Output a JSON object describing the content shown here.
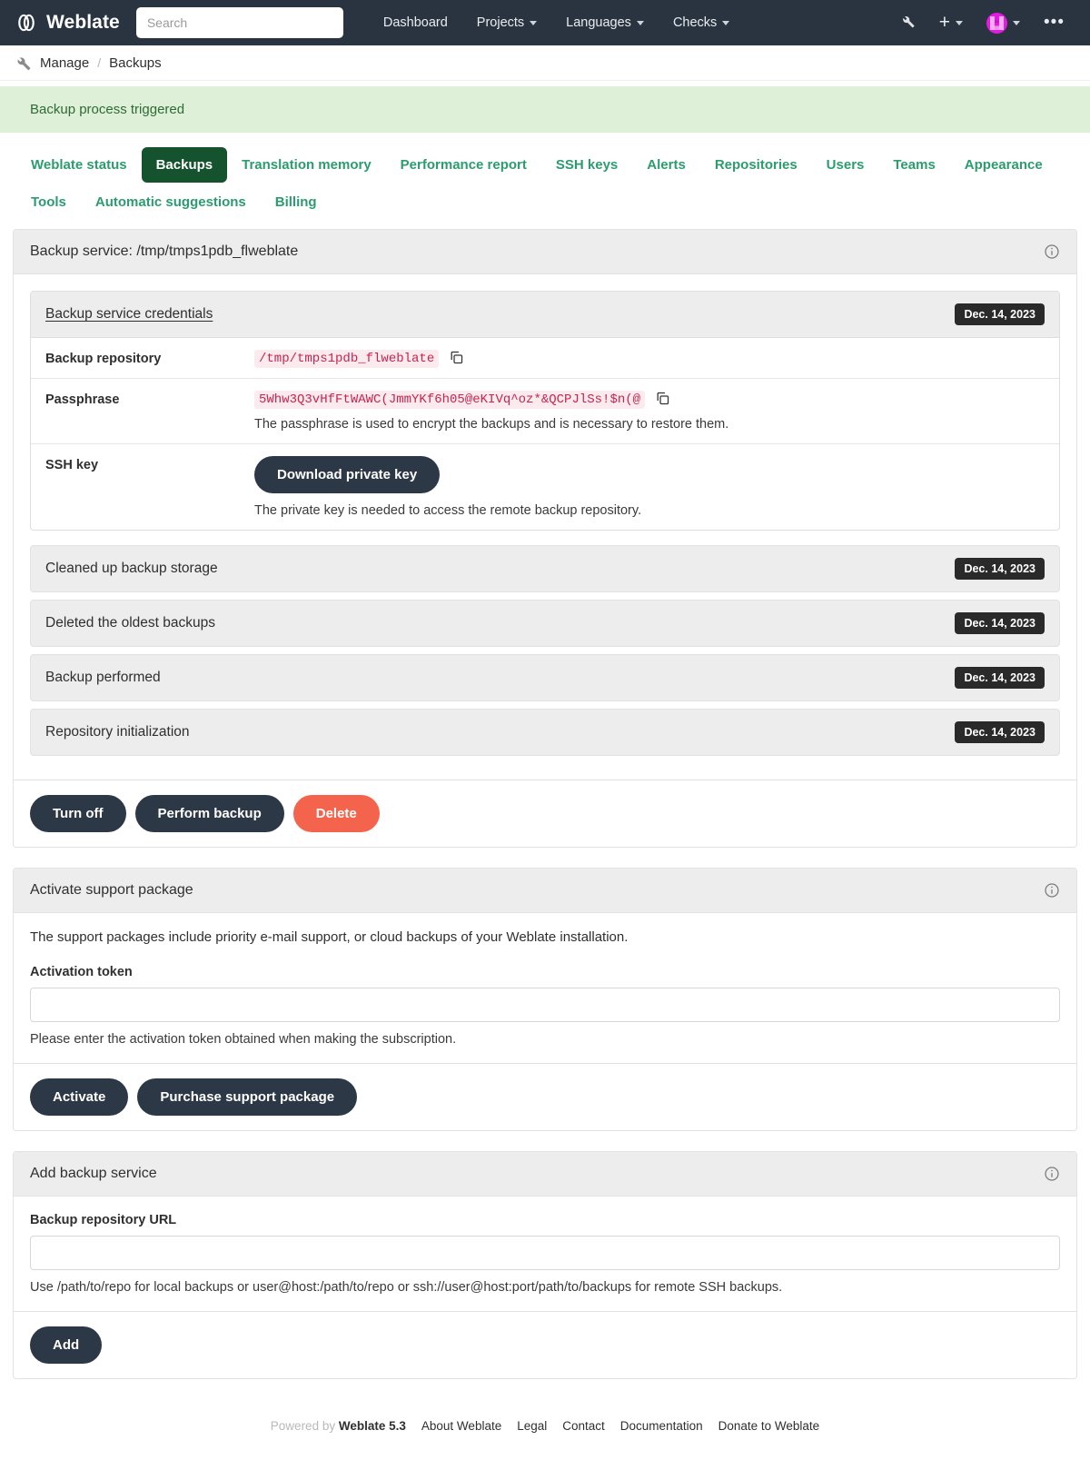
{
  "navbar": {
    "brand": "Weblate",
    "brand_logo_icon": "weblate-logo-icon",
    "search_placeholder": "Search",
    "search_value": "",
    "links": [
      {
        "label": "Dashboard",
        "has_caret": false
      },
      {
        "label": "Projects",
        "has_caret": true
      },
      {
        "label": "Languages",
        "has_caret": true
      },
      {
        "label": "Checks",
        "has_caret": true
      }
    ],
    "right": {
      "wrench_icon": "wrench-icon",
      "plus_glyph": "+",
      "avatar_icon": "user-avatar-icon",
      "more_glyph": "•••"
    }
  },
  "breadcrumb": {
    "icon": "wrench-icon",
    "items": [
      "Manage",
      "Backups"
    ],
    "separator": "/"
  },
  "alert": {
    "message": "Backup process triggered",
    "bg_color": "#dff0d8",
    "text_color": "#2e6b35"
  },
  "tabs": {
    "active": "Backups",
    "items": [
      "Weblate status",
      "Backups",
      "Translation memory",
      "Performance report",
      "SSH keys",
      "Alerts",
      "Repositories",
      "Users",
      "Teams",
      "Appearance",
      "Tools",
      "Automatic suggestions",
      "Billing"
    ],
    "active_bg": "#14532d",
    "link_color": "#2c9c6f"
  },
  "backup_service": {
    "title": "Backup service: /tmp/tmps1pdb_flweblate",
    "info_icon": "info-icon",
    "credentials": {
      "title": "Backup service credentials",
      "date": "Dec. 14, 2023",
      "rows": [
        {
          "label": "Backup repository",
          "value": "/tmp/tmps1pdb_flweblate",
          "copy_icon": "copy-icon",
          "help": ""
        },
        {
          "label": "Passphrase",
          "value": "5Whw3Q3vHfFtWAWC(JmmYKf6h05@eKIVq^oz*&QCPJlSs!$n(@",
          "copy_icon": "copy-icon",
          "help": "The passphrase is used to encrypt the backups and is necessary to restore them."
        }
      ],
      "ssh_key": {
        "label": "SSH key",
        "button_label": "Download private key",
        "help": "The private key is needed to access the remote backup repository."
      }
    },
    "log_entries": [
      {
        "label": "Cleaned up backup storage",
        "date": "Dec. 14, 2023"
      },
      {
        "label": "Deleted the oldest backups",
        "date": "Dec. 14, 2023"
      },
      {
        "label": "Backup performed",
        "date": "Dec. 14, 2023"
      },
      {
        "label": "Repository initialization",
        "date": "Dec. 14, 2023"
      }
    ],
    "actions": {
      "turn_off": "Turn off",
      "perform_backup": "Perform backup",
      "delete": "Delete",
      "delete_color": "#f4644c"
    }
  },
  "support_package": {
    "title": "Activate support package",
    "info_icon": "info-icon",
    "description": "The support packages include priority e-mail support, or cloud backups of your Weblate installation.",
    "token_label": "Activation token",
    "token_value": "",
    "token_placeholder": "",
    "token_help": "Please enter the activation token obtained when making the subscription.",
    "activate_label": "Activate",
    "purchase_label": "Purchase support package"
  },
  "add_backup_service": {
    "title": "Add backup service",
    "info_icon": "info-icon",
    "url_label": "Backup repository URL",
    "url_value": "",
    "url_placeholder": "",
    "url_help": "Use /path/to/repo for local backups or user@host:/path/to/repo or ssh://user@host:port/path/to/backups for remote SSH backups.",
    "add_label": "Add"
  },
  "footer": {
    "powered_prefix": "Powered by",
    "powered_name": "Weblate 5.3",
    "links": [
      "About Weblate",
      "Legal",
      "Contact",
      "Documentation",
      "Donate to Weblate"
    ]
  }
}
